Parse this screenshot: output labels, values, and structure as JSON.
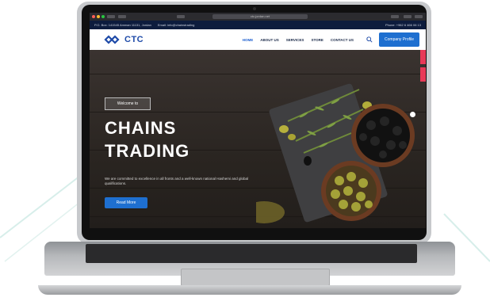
{
  "browser": {
    "url": "ctc-jordan.net"
  },
  "topbar": {
    "address": "P.O. Box: 141545 Amman 11131, Jordan",
    "email": "Email: info@chainstrading",
    "phone": "Phone: +962 6 466 06 13"
  },
  "brand": {
    "logo_text": "CTC",
    "color": "#1e4aa8"
  },
  "nav": {
    "items": [
      {
        "label": "HOME",
        "active": true
      },
      {
        "label": "ABOUT US",
        "active": false
      },
      {
        "label": "SERVICES",
        "active": false
      },
      {
        "label": "STORE",
        "active": false
      },
      {
        "label": "CONTACT US",
        "active": false
      }
    ],
    "search_icon": "search-icon",
    "profile_button": "Company Profile"
  },
  "hero": {
    "badge": "Welcome to",
    "title_line1": "CHAINS",
    "title_line2": "TRADING",
    "description": "We are committed to excellence in all fronts and a well-known national Hashemi and global qualifications.",
    "button_label": "Read More"
  },
  "colors": {
    "accent": "#1e6fd0",
    "topbar": "#0d1c3d",
    "side_tab": "#e83a58"
  }
}
